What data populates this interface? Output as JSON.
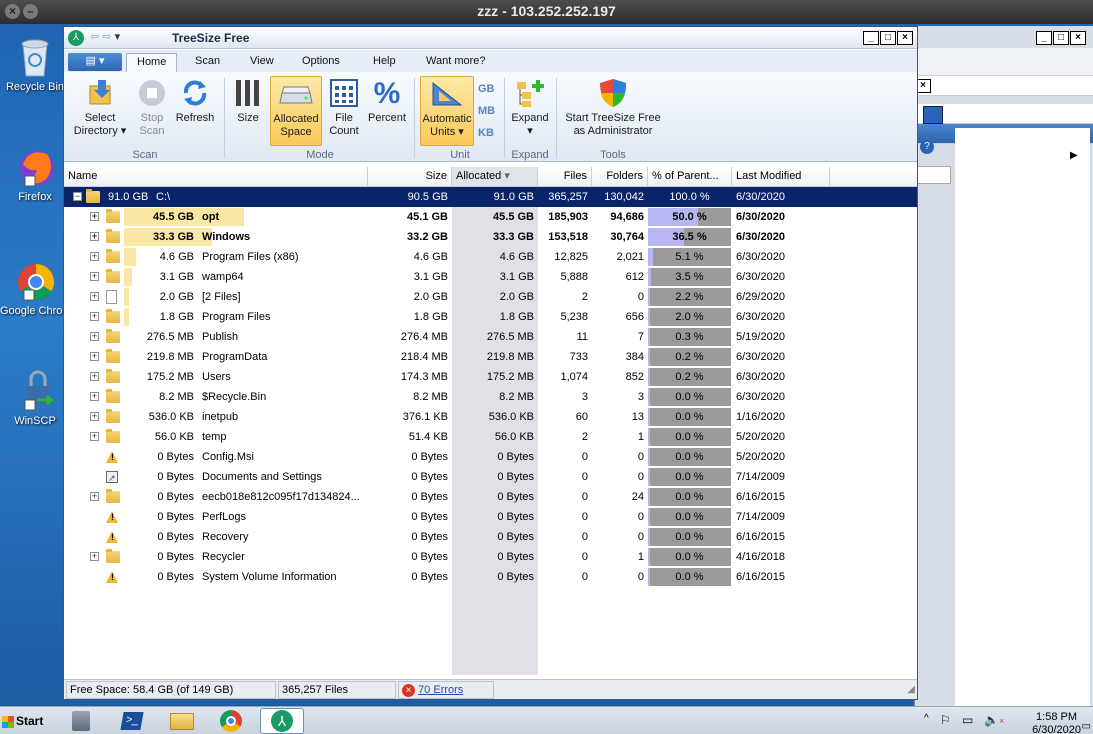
{
  "remote_title": "zzz - 103.252.252.197",
  "desktop": [
    {
      "label": "Recycle Bin",
      "icon": "recycle-bin-icon"
    },
    {
      "label": "Firefox",
      "icon": "firefox-icon"
    },
    {
      "label": "Google Chrome",
      "icon": "chrome-icon"
    },
    {
      "label": "WinSCP",
      "icon": "winscp-icon"
    }
  ],
  "app": {
    "title": "TreeSize Free"
  },
  "tabs": [
    "Home",
    "Scan",
    "View",
    "Options",
    "Help",
    "Want more?"
  ],
  "ribbon": {
    "select_dir": [
      "Select",
      "Directory ▾"
    ],
    "stop_scan": [
      "Stop",
      "Scan"
    ],
    "refresh": "Refresh",
    "size": "Size",
    "allocated": [
      "Allocated",
      "Space"
    ],
    "file_count": [
      "File",
      "Count"
    ],
    "percent": "Percent",
    "auto_units": [
      "Automatic",
      "Units ▾"
    ],
    "units": [
      "GB",
      "MB",
      "KB"
    ],
    "expand": [
      "Expand",
      "▾"
    ],
    "admin": [
      "Start TreeSize Free",
      "as Administrator"
    ],
    "groups": {
      "scan": "Scan",
      "mode": "Mode",
      "unit": "Unit",
      "expand": "Expand",
      "tools": "Tools"
    }
  },
  "columns": [
    "Name",
    "Size",
    "Allocated",
    "Files",
    "Folders",
    "% of Parent...",
    "Last Modified"
  ],
  "root": {
    "total": "91.0 GB",
    "name": "C:\\",
    "size": "90.5 GB",
    "allocated": "91.0 GB",
    "files": "365,257",
    "folders": "130,042",
    "percent": "100.0 %",
    "modified": "6/30/2020"
  },
  "rows": [
    {
      "total": "45.5 GB",
      "name": "opt",
      "size": "45.1 GB",
      "allocated": "45.5 GB",
      "files": "185,903",
      "folders": "94,686",
      "percent": "50.0 %",
      "pct": 50.0,
      "modified": "6/30/2020",
      "icon": "folder",
      "expand": true,
      "bold": true
    },
    {
      "total": "33.3 GB",
      "name": "Windows",
      "size": "33.2 GB",
      "allocated": "33.3 GB",
      "files": "153,518",
      "folders": "30,764",
      "percent": "36.5 %",
      "pct": 36.5,
      "modified": "6/30/2020",
      "icon": "folder",
      "expand": true,
      "bold": true
    },
    {
      "total": "4.6 GB",
      "name": "Program Files (x86)",
      "size": "4.6 GB",
      "allocated": "4.6 GB",
      "files": "12,825",
      "folders": "2,021",
      "percent": "5.1 %",
      "pct": 5.1,
      "modified": "6/30/2020",
      "icon": "folder",
      "expand": true
    },
    {
      "total": "3.1 GB",
      "name": "wamp64",
      "size": "3.1 GB",
      "allocated": "3.1 GB",
      "files": "5,888",
      "folders": "612",
      "percent": "3.5 %",
      "pct": 3.5,
      "modified": "6/30/2020",
      "icon": "folder",
      "expand": true
    },
    {
      "total": "2.0 GB",
      "name": "[2 Files]",
      "size": "2.0 GB",
      "allocated": "2.0 GB",
      "files": "2",
      "folders": "0",
      "percent": "2.2 %",
      "pct": 2.2,
      "modified": "6/29/2020",
      "icon": "file",
      "expand": true
    },
    {
      "total": "1.8 GB",
      "name": "Program Files",
      "size": "1.8 GB",
      "allocated": "1.8 GB",
      "files": "5,238",
      "folders": "656",
      "percent": "2.0 %",
      "pct": 2.0,
      "modified": "6/30/2020",
      "icon": "folder",
      "expand": true
    },
    {
      "total": "276.5 MB",
      "name": "Publish",
      "size": "276.4 MB",
      "allocated": "276.5 MB",
      "files": "11",
      "folders": "7",
      "percent": "0.3 %",
      "pct": 0.3,
      "modified": "5/19/2020",
      "icon": "folder",
      "expand": true
    },
    {
      "total": "219.8 MB",
      "name": "ProgramData",
      "size": "218.4 MB",
      "allocated": "219.8 MB",
      "files": "733",
      "folders": "384",
      "percent": "0.2 %",
      "pct": 0.2,
      "modified": "6/30/2020",
      "icon": "folder",
      "expand": true
    },
    {
      "total": "175.2 MB",
      "name": "Users",
      "size": "174.3 MB",
      "allocated": "175.2 MB",
      "files": "1,074",
      "folders": "852",
      "percent": "0.2 %",
      "pct": 0.2,
      "modified": "6/30/2020",
      "icon": "folder",
      "expand": true
    },
    {
      "total": "8.2 MB",
      "name": "$Recycle.Bin",
      "size": "8.2 MB",
      "allocated": "8.2 MB",
      "files": "3",
      "folders": "3",
      "percent": "0.0 %",
      "pct": 0,
      "modified": "6/30/2020",
      "icon": "folder",
      "expand": true
    },
    {
      "total": "536.0 KB",
      "name": "inetpub",
      "size": "376.1 KB",
      "allocated": "536.0 KB",
      "files": "60",
      "folders": "13",
      "percent": "0.0 %",
      "pct": 0,
      "modified": "1/16/2020",
      "icon": "folder",
      "expand": true
    },
    {
      "total": "56.0 KB",
      "name": "temp",
      "size": "51.4 KB",
      "allocated": "56.0 KB",
      "files": "2",
      "folders": "1",
      "percent": "0.0 %",
      "pct": 0,
      "modified": "5/20/2020",
      "icon": "folder",
      "expand": true
    },
    {
      "total": "0 Bytes",
      "name": "Config.Msi",
      "size": "0 Bytes",
      "allocated": "0 Bytes",
      "files": "0",
      "folders": "0",
      "percent": "0.0 %",
      "pct": 0,
      "modified": "5/20/2020",
      "icon": "warn",
      "expand": false
    },
    {
      "total": "0 Bytes",
      "name": "Documents and Settings",
      "size": "0 Bytes",
      "allocated": "0 Bytes",
      "files": "0",
      "folders": "0",
      "percent": "0.0 %",
      "pct": 0,
      "modified": "7/14/2009",
      "icon": "link",
      "expand": false
    },
    {
      "total": "0 Bytes",
      "name": "eecb018e812c095f17d134824...",
      "size": "0 Bytes",
      "allocated": "0 Bytes",
      "files": "0",
      "folders": "24",
      "percent": "0.0 %",
      "pct": 0,
      "modified": "6/16/2015",
      "icon": "folder",
      "expand": true
    },
    {
      "total": "0 Bytes",
      "name": "PerfLogs",
      "size": "0 Bytes",
      "allocated": "0 Bytes",
      "files": "0",
      "folders": "0",
      "percent": "0.0 %",
      "pct": 0,
      "modified": "7/14/2009",
      "icon": "warn",
      "expand": false
    },
    {
      "total": "0 Bytes",
      "name": "Recovery",
      "size": "0 Bytes",
      "allocated": "0 Bytes",
      "files": "0",
      "folders": "0",
      "percent": "0.0 %",
      "pct": 0,
      "modified": "6/16/2015",
      "icon": "warn",
      "expand": false
    },
    {
      "total": "0 Bytes",
      "name": "Recycler",
      "size": "0 Bytes",
      "allocated": "0 Bytes",
      "files": "0",
      "folders": "1",
      "percent": "0.0 %",
      "pct": 0,
      "modified": "4/16/2018",
      "icon": "folder",
      "expand": true
    },
    {
      "total": "0 Bytes",
      "name": "System Volume Information",
      "size": "0 Bytes",
      "allocated": "0 Bytes",
      "files": "0",
      "folders": "0",
      "percent": "0.0 %",
      "pct": 0,
      "modified": "6/16/2015",
      "icon": "warn",
      "expand": false
    }
  ],
  "status": {
    "free_space": "Free Space: 58.4 GB  (of 149 GB)",
    "files": "365,257 Files",
    "errors": "70 Errors"
  },
  "taskbar": {
    "start": "Start",
    "time": "1:58 PM",
    "date": "6/30/2020"
  }
}
